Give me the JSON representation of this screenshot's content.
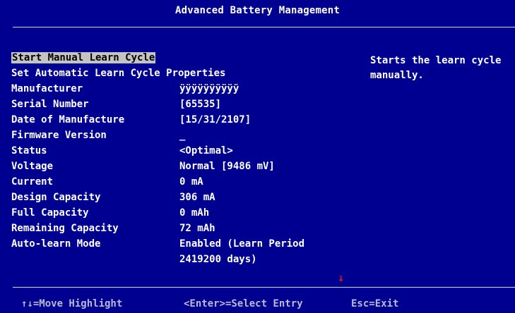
{
  "header": {
    "title": "Advanced Battery Management"
  },
  "menu": {
    "items": [
      {
        "label": "Start Manual Learn Cycle",
        "value": "",
        "selected": true
      },
      {
        "label": "Set Automatic Learn Cycle Properties",
        "value": ""
      },
      {
        "label": "Manufacturer",
        "value": "ÿÿÿÿÿÿÿÿÿÿ"
      },
      {
        "label": "Serial Number",
        "value": "[65535]"
      },
      {
        "label": "Date of Manufacture",
        "value": "[15/31/2107]"
      },
      {
        "label": "Firmware Version",
        "value": "_"
      },
      {
        "label": "Status",
        "value": "<Optimal>"
      },
      {
        "label": "Voltage",
        "value": "Normal [9486 mV]"
      },
      {
        "label": "Current",
        "value": "0 mA"
      },
      {
        "label": "Design Capacity",
        "value": "306 mA"
      },
      {
        "label": "Full Capacity",
        "value": "0 mAh"
      },
      {
        "label": "Remaining Capacity",
        "value": "72 mAh"
      },
      {
        "label": "Auto-learn Mode",
        "value": "Enabled (Learn Period",
        "value2": "2419200 days)"
      }
    ]
  },
  "help": {
    "text": "Starts the learn cycle\nmanually."
  },
  "scroll_indicator": "↓",
  "footer": {
    "move": "↑↓=Move Highlight",
    "enter": "<Enter>=Select Entry",
    "esc": "Esc=Exit"
  },
  "colors": {
    "background": "#000090",
    "highlight": "#c4c4c4",
    "arrow": "#e11b1b"
  }
}
